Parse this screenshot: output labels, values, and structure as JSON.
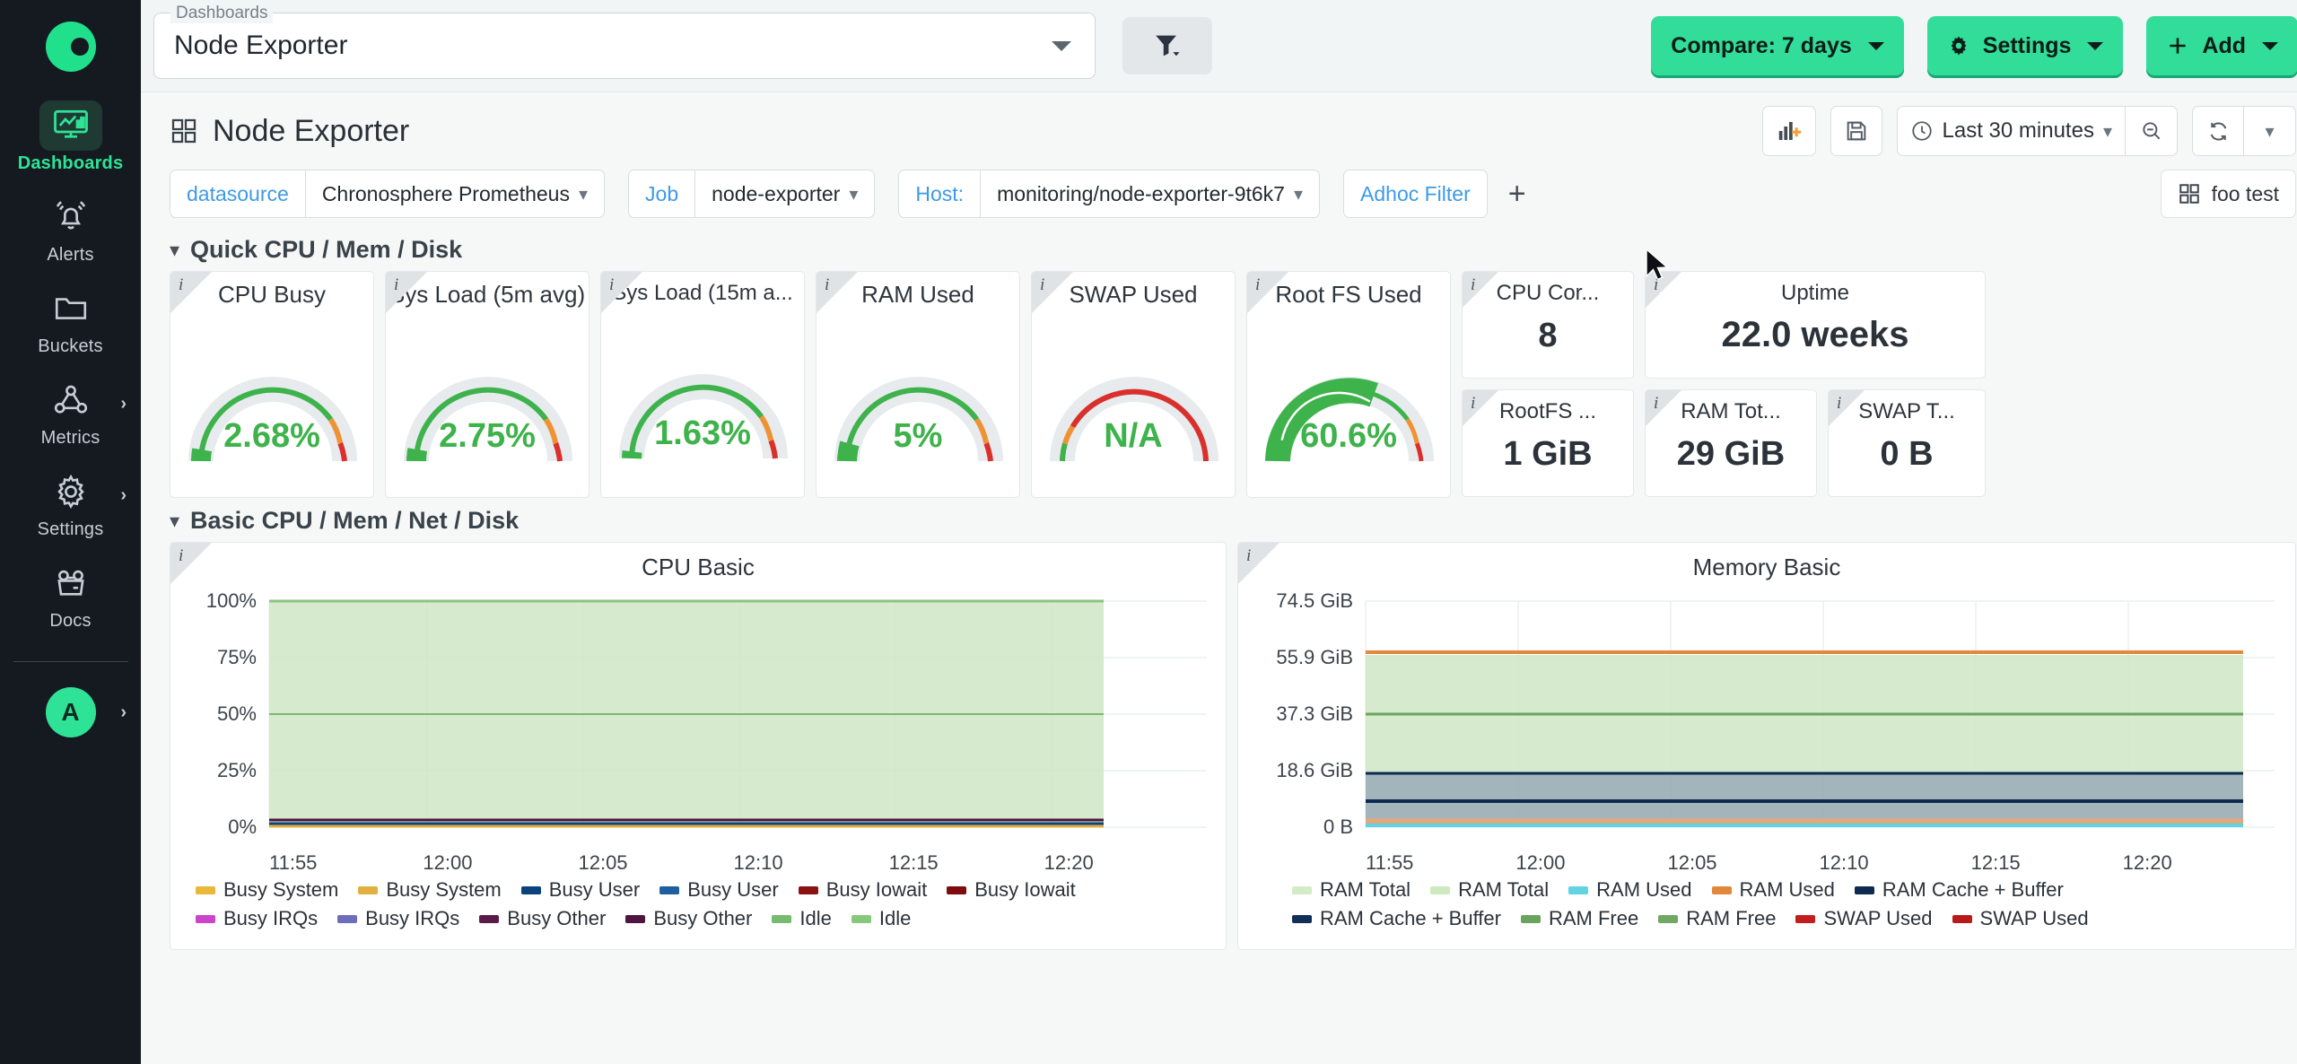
{
  "sidebar": {
    "logo_name": "chronosphere-logo",
    "items": [
      {
        "label": "Dashboards",
        "icon": "dashboard-icon",
        "active": true,
        "chevron": false
      },
      {
        "label": "Alerts",
        "icon": "bell-icon",
        "active": false,
        "chevron": false
      },
      {
        "label": "Buckets",
        "icon": "folder-icon",
        "active": false,
        "chevron": false
      },
      {
        "label": "Metrics",
        "icon": "graph-node-icon",
        "active": false,
        "chevron": true
      },
      {
        "label": "Settings",
        "icon": "gear-icon",
        "active": false,
        "chevron": true
      },
      {
        "label": "Docs",
        "icon": "open-box-icon",
        "active": false,
        "chevron": false
      }
    ],
    "avatar_initial": "A"
  },
  "appbar": {
    "dashboard_select_legend": "Dashboards",
    "dashboard_select_value": "Node Exporter",
    "filter_button": "filter-icon",
    "compare_label": "Compare: 7 days",
    "settings_label": "Settings",
    "add_label": "Add"
  },
  "toolbar": {
    "page_title": "Node Exporter",
    "add_panel_icon": "add-panel-icon",
    "save_icon": "save-icon",
    "time_range": "Last 30 minutes",
    "zoom_out_icon": "zoom-out-icon",
    "refresh_icon": "refresh-icon"
  },
  "variables": [
    {
      "label": "datasource",
      "value": "Chronosphere Prometheus",
      "has_value": true
    },
    {
      "label": "Job",
      "value": "node-exporter",
      "has_value": true
    },
    {
      "label": "Host:",
      "value": "monitoring/node-exporter-9t6k7",
      "has_value": true
    },
    {
      "label": "Adhoc Filter",
      "value": "",
      "has_value": false
    }
  ],
  "foo_test_label": "foo test",
  "rows": [
    {
      "title": "Quick CPU / Mem / Disk"
    },
    {
      "title": "Basic CPU / Mem / Net / Disk"
    }
  ],
  "gauges": [
    {
      "title": "CPU Busy",
      "value": "2.68%",
      "pct": 2.68
    },
    {
      "title": "Sys Load (5m avg)",
      "value": "2.75%",
      "pct": 2.75
    },
    {
      "title": "Sys Load (15m a...",
      "value": "1.63%",
      "pct": 1.63
    },
    {
      "title": "RAM Used",
      "value": "5%",
      "pct": 5
    },
    {
      "title": "SWAP Used",
      "value": "N/A",
      "pct": 0
    },
    {
      "title": "Root FS Used",
      "value": "60.6%",
      "pct": 60.6
    }
  ],
  "stats": [
    {
      "title": "CPU Cor...",
      "value": "8"
    },
    {
      "title": "Uptime",
      "value": "22.0 weeks"
    },
    {
      "title": "RootFS ...",
      "value": "1 GiB"
    },
    {
      "title": "RAM Tot...",
      "value": "29 GiB"
    },
    {
      "title": "SWAP T...",
      "value": "0 B"
    }
  ],
  "chart_data": [
    {
      "type": "area",
      "title": "CPU Basic",
      "xlabel": "",
      "ylabel": "",
      "ylim": [
        0,
        100
      ],
      "yticks": [
        "0%",
        "25%",
        "50%",
        "75%",
        "100%"
      ],
      "xticks": [
        "11:55",
        "12:00",
        "12:05",
        "12:10",
        "12:15",
        "12:20"
      ],
      "grid": true,
      "legend_position": "bottom",
      "series": [
        {
          "name": "Busy System",
          "color": "#eab839",
          "value": 1.1
        },
        {
          "name": "Busy System",
          "color": "#e0b040",
          "value": 1.1
        },
        {
          "name": "Busy User",
          "color": "#0a437c",
          "value": 1.4
        },
        {
          "name": "Busy User",
          "color": "#1f5f9e",
          "value": 1.4
        },
        {
          "name": "Busy Iowait",
          "color": "#8c1111",
          "value": 0.1
        },
        {
          "name": "Busy Iowait",
          "color": "#7e0c0c",
          "value": 0.1
        },
        {
          "name": "Busy IRQs",
          "color": "#cb44c9",
          "value": 0.2
        },
        {
          "name": "Busy IRQs",
          "color": "#6e6dbb",
          "value": 0.2
        },
        {
          "name": "Busy Other",
          "color": "#5c1a48",
          "value": 0.2
        },
        {
          "name": "Busy Other",
          "color": "#4d1540",
          "value": 0.2
        },
        {
          "name": "Idle",
          "color": "#76bb6e",
          "value": 97.3
        },
        {
          "name": "Idle",
          "color": "#86c97c",
          "value": 97.3
        }
      ]
    },
    {
      "type": "area",
      "title": "Memory Basic",
      "xlabel": "",
      "ylabel": "",
      "ylim": [
        0,
        74.5
      ],
      "yticks": [
        "0 B",
        "18.6 GiB",
        "37.3 GiB",
        "55.9 GiB",
        "74.5 GiB"
      ],
      "xticks": [
        "11:55",
        "12:00",
        "12:05",
        "12:10",
        "12:15",
        "12:20"
      ],
      "grid": true,
      "legend_position": "bottom",
      "series": [
        {
          "name": "RAM Total",
          "color": "#d4ecc6",
          "value": 56.5
        },
        {
          "name": "RAM Total",
          "color": "#cdeabe",
          "value": 56.5
        },
        {
          "name": "RAM Used",
          "color": "#62d3e0",
          "value": 1.1
        },
        {
          "name": "RAM Used",
          "color": "#e2883b",
          "value": 1.1
        },
        {
          "name": "RAM Cache + Buffer",
          "color": "#0e2a4f",
          "value": 17.5
        },
        {
          "name": "RAM Cache + Buffer",
          "color": "#122f58",
          "value": 17.5
        },
        {
          "name": "RAM Free",
          "color": "#6aa35e",
          "value": 37.3
        },
        {
          "name": "RAM Free",
          "color": "#6fa863",
          "value": 37.3
        },
        {
          "name": "SWAP Used",
          "color": "#c41d1d",
          "value": 0
        },
        {
          "name": "SWAP Used",
          "color": "#b81a1a",
          "value": 0
        }
      ]
    }
  ],
  "colors": {
    "accent_green": "#32dd9a",
    "link_blue": "#3d9ae8",
    "gauge_green": "#3eb24b",
    "gauge_orange": "#ef9234",
    "gauge_red": "#d9302c"
  }
}
